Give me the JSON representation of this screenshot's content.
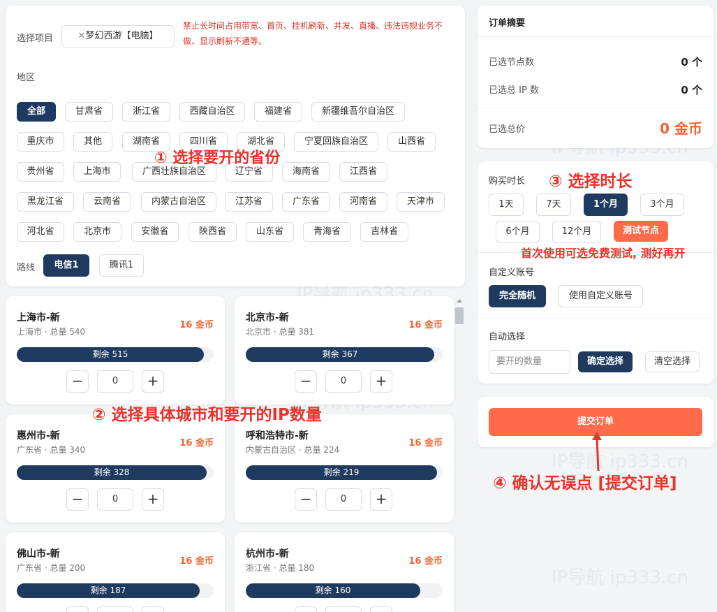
{
  "filter": {
    "project_label": "选择项目",
    "project_tag": "梦幻西游【电脑】",
    "warning": [
      "禁止长时间占用带宽、首页、挂机刷新、并发、直播、违法违规业务不",
      "做、显示刷新不通等。"
    ],
    "region_label": "地区",
    "regions": [
      "全部",
      "甘肃省",
      "浙江省",
      "西藏自治区",
      "福建省",
      "新疆维吾尔自治区",
      "重庆市",
      "其他",
      "湖南省",
      "四川省",
      "湖北省",
      "宁夏回族自治区",
      "山西省",
      "贵州省",
      "上海市",
      "广西壮族自治区",
      "辽宁省",
      "海南省",
      "江西省",
      "黑龙江省",
      "云南省",
      "内蒙古自治区",
      "江苏省",
      "广东省",
      "河南省",
      "天津市",
      "河北省",
      "北京市",
      "安徽省",
      "陕西省",
      "山东省",
      "青海省",
      "吉林省"
    ],
    "route_label": "路线",
    "routes": [
      "电信1",
      "腾讯1"
    ]
  },
  "cities": [
    {
      "name": "上海市-新",
      "sub": "上海市 · 总量 540",
      "price": "16 金币",
      "remain": "剩余 515",
      "remain_fraction": 0.954,
      "qty": "0"
    },
    {
      "name": "北京市-新",
      "sub": "北京市 · 总量 381",
      "price": "16 金币",
      "remain": "剩余 367",
      "remain_fraction": 0.963,
      "qty": "0"
    },
    {
      "name": "惠州市-新",
      "sub": "广东省 · 总量 340",
      "price": "16 金币",
      "remain": "剩余 328",
      "remain_fraction": 0.965,
      "qty": "0"
    },
    {
      "name": "呼和浩特市-新",
      "sub": "内蒙古自治区 · 总量 224",
      "price": "16 金币",
      "remain": "剩余 219",
      "remain_fraction": 0.978,
      "qty": "0"
    },
    {
      "name": "佛山市-新",
      "sub": "广东省 · 总量 200",
      "price": "16 金币",
      "remain": "剩余 187",
      "remain_fraction": 0.935,
      "qty": ""
    },
    {
      "name": "杭州市-新",
      "sub": "浙江省 · 总量 180",
      "price": "16 金币",
      "remain": "剩余 160",
      "remain_fraction": 0.889,
      "qty": ""
    }
  ],
  "summary": {
    "title": "订单摘要",
    "nodes_label": "已选节点数",
    "nodes_value": "0 个",
    "ips_label": "已选总 IP 数",
    "ips_value": "0 个",
    "price_label": "已选总价",
    "price_value": "0 金币"
  },
  "options": {
    "duration_label": "购买时长",
    "durations": [
      "1天",
      "7天",
      "1个月",
      "3个月",
      "6个月",
      "12个月",
      "测试节点"
    ],
    "account_label": "自定义账号",
    "account_random": "完全随机",
    "account_custom": "使用自定义账号",
    "auto_label": "自动选择",
    "auto_placeholder": "要开的数量",
    "auto_confirm": "确定选择",
    "auto_clear": "清空选择"
  },
  "submit_label": "提交订单",
  "annotations": {
    "a1": "① 选择要开的省份",
    "a2": "② 选择具体城市和要开的IP数量",
    "a3": "③ 选择时长",
    "a3_note": "首次使用可选免费测试, 测好再开",
    "a4": "④ 确认无误点 [提交订单]"
  },
  "watermark": "IP导航 ip333.cn",
  "colors": {
    "primary": "#1f3a5f",
    "accent": "#f0642f",
    "submit": "#ff6b4a",
    "annotation": "#e8322a"
  }
}
